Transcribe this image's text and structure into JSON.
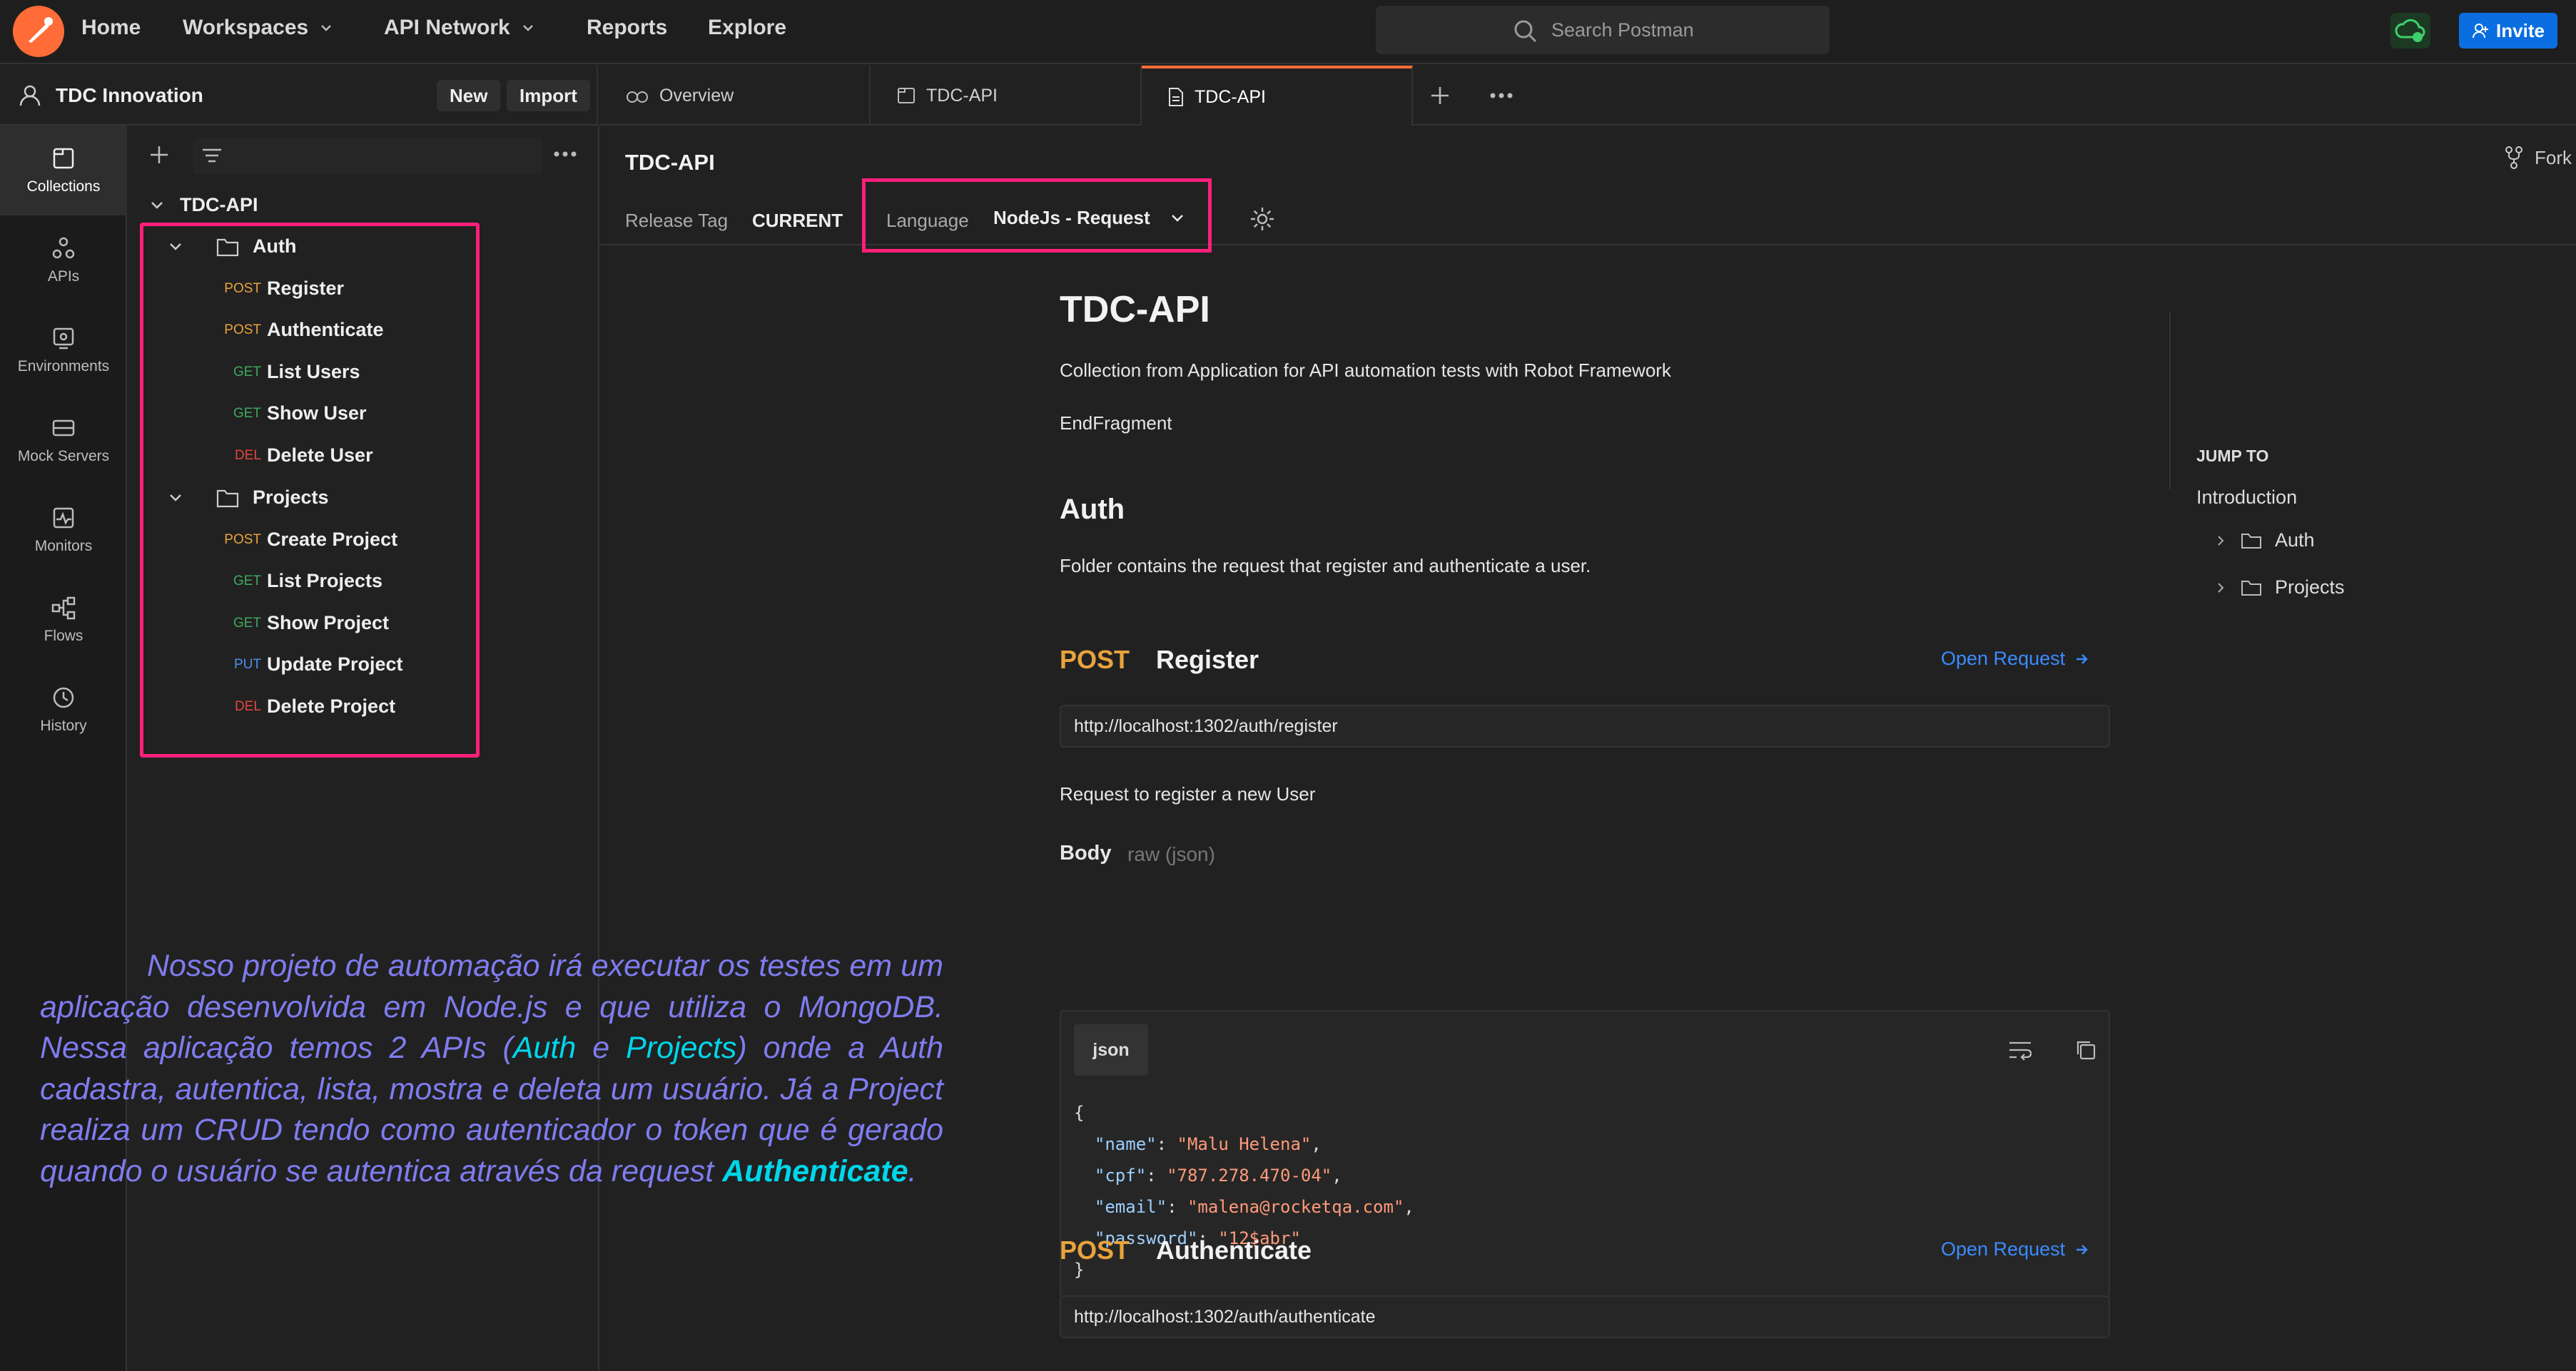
{
  "topbar": {
    "nav": [
      "Home",
      "Workspaces",
      "API Network",
      "Reports",
      "Explore"
    ],
    "search_placeholder": "Search Postman",
    "invite_label": "Invite"
  },
  "workspace": {
    "name": "TDC Innovation",
    "new_label": "New",
    "import_label": "Import"
  },
  "tabs": [
    {
      "label": "Overview"
    },
    {
      "label": "TDC-API"
    },
    {
      "label": "TDC-API"
    }
  ],
  "rail": [
    "Collections",
    "APIs",
    "Environments",
    "Mock Servers",
    "Monitors",
    "Flows",
    "History"
  ],
  "tree": {
    "root": "TDC-API",
    "folders": [
      {
        "name": "Auth",
        "requests": [
          {
            "method": "POST",
            "name": "Register"
          },
          {
            "method": "POST",
            "name": "Authenticate"
          },
          {
            "method": "GET",
            "name": "List Users"
          },
          {
            "method": "GET",
            "name": "Show User"
          },
          {
            "method": "DEL",
            "name": "Delete User"
          }
        ]
      },
      {
        "name": "Projects",
        "requests": [
          {
            "method": "POST",
            "name": "Create Project"
          },
          {
            "method": "GET",
            "name": "List Projects"
          },
          {
            "method": "GET",
            "name": "Show Project"
          },
          {
            "method": "PUT",
            "name": "Update Project"
          },
          {
            "method": "DEL",
            "name": "Delete Project"
          }
        ]
      }
    ]
  },
  "doc_header": {
    "title": "TDC-API",
    "release_label": "Release Tag",
    "release_value": "CURRENT",
    "language_label": "Language",
    "language_value": "NodeJs - Request",
    "fork_label": "Fork"
  },
  "doc": {
    "title": "TDC-API",
    "description": "Collection from Application for API automation tests with Robot Framework",
    "fragment": "EndFragment",
    "auth_heading": "Auth",
    "auth_desc": "Folder contains the request that register and authenticate a user.",
    "req1": {
      "method": "POST",
      "name": "Register",
      "open": "Open Request",
      "url": "http://localhost:1302/auth/register",
      "desc": "Request to register a new User",
      "body_label": "Body",
      "body_type": "raw (json)",
      "lang_tag": "json",
      "json_open": "{",
      "json_close": "}",
      "json": [
        {
          "k": "\"name\"",
          "v": "\"Malu Helena\""
        },
        {
          "k": "\"cpf\"",
          "v": "\"787.278.470-04\""
        },
        {
          "k": "\"email\"",
          "v": "\"malena@rocketqa.com\""
        },
        {
          "k": "\"password\"",
          "v": "\"12$abr\""
        }
      ]
    },
    "req2": {
      "method": "POST",
      "name": "Authenticate",
      "open": "Open Request",
      "url": "http://localhost:1302/auth/authenticate"
    }
  },
  "jump_to": {
    "heading": "JUMP TO",
    "items": [
      "Introduction",
      "Auth",
      "Projects"
    ]
  },
  "overlay": {
    "p1": "Nosso projeto de automação irá executar os testes em um aplicação desenvolvida em Node.js e que utiliza o MongoDB. Nessa aplicação temos 2 APIs (",
    "auth": "Auth",
    "e": " e ",
    "projects": "Projects",
    "p2": ") onde a Auth cadastra, autentica, lista, mostra e deleta um usuário. Já a Project realiza um CRUD tendo como autenticador o token que é gerado quando o usuário se autentica através da request ",
    "authenticate": "Authenticate",
    "dot": "."
  },
  "colors": {
    "accent": "#ff6c37",
    "highlight_box": "#ff1f7a",
    "post": "#e8a33c",
    "get": "#3fa95e",
    "del": "#e2473f",
    "put": "#4b8ef0",
    "link": "#3b8bff"
  }
}
